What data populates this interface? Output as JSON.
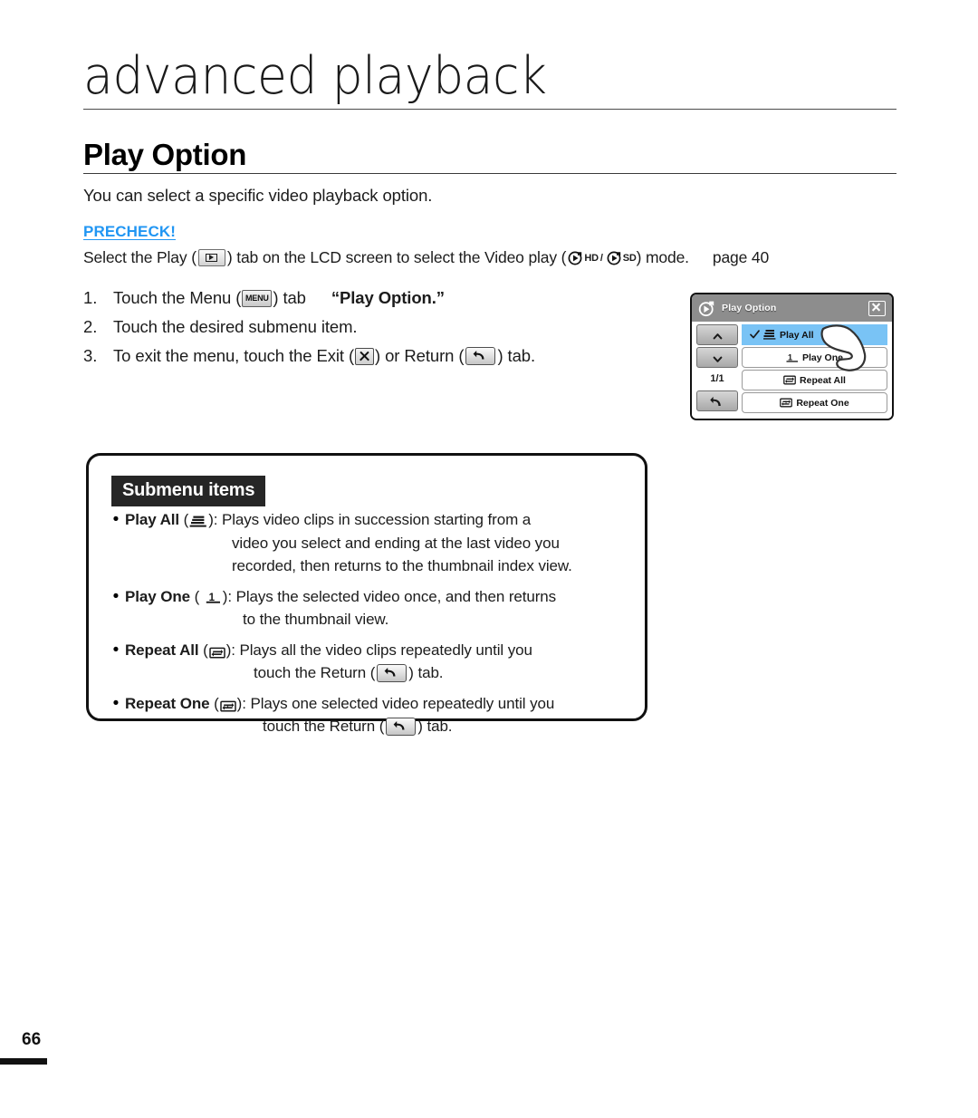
{
  "page": {
    "chapter_title": "advanced playback",
    "section_heading": "Play Option",
    "intro": "You can select a specific video playback option.",
    "page_number": "66"
  },
  "precheck": {
    "label": "PRECHECK!",
    "text_before_play_icon": "Select the Play (",
    "text_after_play_icon": ") tab on the LCD screen to select the Video play (",
    "hd_label": "HD",
    "separator": "/",
    "sd_label": "SD",
    "text_after_mode": " ) mode.",
    "page_ref": "page 40"
  },
  "steps": [
    {
      "num": "1.",
      "text_before_icon": "Touch the Menu (",
      "icon_label": "MENU",
      "text_after_icon": ") tab",
      "quoted": "“Play Option.”"
    },
    {
      "num": "2.",
      "text": "Touch the desired submenu item."
    },
    {
      "num": "3.",
      "text_before_exit": "To exit the menu, touch the Exit (",
      "text_between": ") or Return (",
      "text_after": ") tab."
    }
  ],
  "lcd": {
    "title": "Play Option",
    "title_icon": "video-play-icon",
    "close_icon": "close-icon",
    "page_indicator": "1/1",
    "up_icon": "chevron-up-icon",
    "down_icon": "chevron-down-icon",
    "return_icon": "return-icon",
    "highlight_color": "#79c3f5",
    "titlebar_color": "#8d8d8d",
    "items": [
      {
        "label": "Play All",
        "icon": "play-all-icon",
        "selected": true
      },
      {
        "label": "Play One",
        "icon": "play-one-icon",
        "selected": false
      },
      {
        "label": "Repeat All",
        "icon": "repeat-all-icon",
        "selected": false
      },
      {
        "label": "Repeat One",
        "icon": "repeat-one-icon",
        "selected": false
      }
    ]
  },
  "submenu": {
    "badge": "Submenu items",
    "items": [
      {
        "term": "Play All",
        "icon": "play-all-icon",
        "lines": [
          ": Plays video clips in succession starting from a",
          "video you select and ending at the last video you",
          "recorded, then returns to the thumbnail index view."
        ]
      },
      {
        "term": "Play One",
        "icon": "play-one-icon",
        "lines": [
          ": Plays the selected video once, and then returns",
          "to the thumbnail view."
        ]
      },
      {
        "term": "Repeat All",
        "icon": "repeat-all-icon",
        "lines_before_return": ": Plays all the video clips repeatedly until you",
        "return_prefix": "touch the Return (",
        "return_suffix": ") tab."
      },
      {
        "term": "Repeat One",
        "icon": "repeat-one-icon",
        "lines_before_return": ": Plays one selected video repeatedly until you",
        "return_prefix": "touch the Return (",
        "return_suffix": ") tab."
      }
    ]
  },
  "colors": {
    "precheck_blue": "#2196f3",
    "lcd_highlight": "#79c3f5",
    "lcd_titlebar": "#8d8d8d",
    "badge_bg": "#262626"
  }
}
